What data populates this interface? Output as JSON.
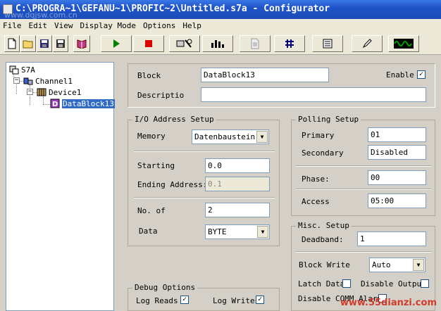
{
  "window": {
    "title": "C:\\PROGRA~1\\GEFANU~1\\PROFIC~2\\Untitled.s7a - Configurator",
    "watermark_top": "www.dqjsw.com.cn",
    "watermark_bottom": "www.55dianzi.com"
  },
  "menu": [
    "File",
    "Edit",
    "View",
    "Display Mode",
    "Options",
    "Help"
  ],
  "toolbar": {
    "icons": [
      "new-file-icon",
      "open-folder-icon",
      "save-icon",
      "save-all-icon",
      "book-icon",
      "play-icon",
      "stop-icon",
      "device-settings-icon",
      "bar-chart-icon",
      "document-icon",
      "grid-icon",
      "properties-icon",
      "pen-icon",
      "waveform-icon"
    ],
    "colors": {
      "play": "#008000",
      "stop": "#e00000",
      "waveform": "#00a000"
    }
  },
  "tree": {
    "root": "S7A",
    "channel": "Channel1",
    "device": "Device1",
    "block": "DataBlock13"
  },
  "block": {
    "block_label": "Block",
    "block_value": "DataBlock13",
    "enable_label": "Enable",
    "enable_checked": "✓",
    "description_label": "Descriptio",
    "description_value": ""
  },
  "io": {
    "legend": "I/O Address Setup",
    "memory_label": "Memory",
    "memory_value": "Datenbaustein",
    "starting_label": "Starting",
    "starting_value": "0.0",
    "ending_label": "Ending Address:",
    "ending_value": "0.1",
    "no_of_label": "No. of",
    "no_of_value": "2",
    "data_label": "Data",
    "data_value": "BYTE"
  },
  "polling": {
    "legend": "Polling Setup",
    "primary_label": "Primary",
    "primary_value": "01",
    "secondary_label": "Secondary",
    "secondary_value": "Disabled",
    "phase_label": "Phase:",
    "phase_value": "00",
    "access_label": "Access",
    "access_value": "05:00"
  },
  "misc": {
    "legend": "Misc. Setup",
    "deadband_label": "Deadband:",
    "deadband_value": "1",
    "block_write_label": "Block Write",
    "block_write_value": "Auto",
    "latch_label": "Latch Data",
    "disable_output_label": "Disable Output",
    "disable_comm_label": "Disable COMM Alarms"
  },
  "debug": {
    "legend": "Debug Options",
    "log_reads_label": "Log Reads",
    "log_reads_checked": "✓",
    "log_writes_label": "Log Writes",
    "log_writes_checked": "✓"
  }
}
